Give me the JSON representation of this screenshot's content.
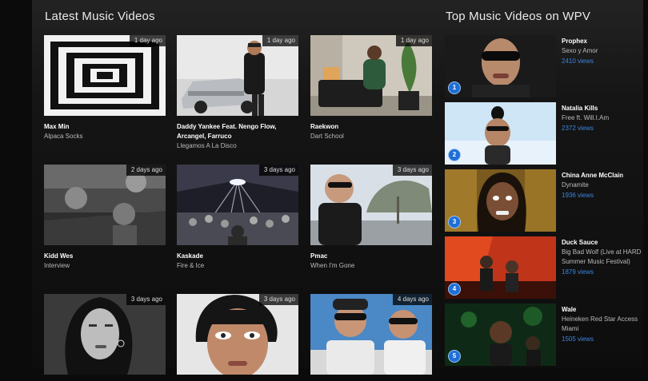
{
  "latest": {
    "title": "Latest Music Videos",
    "items": [
      {
        "age": "1 day ago",
        "artist": "Max Min",
        "song": "Alpaca Socks"
      },
      {
        "age": "1 day ago",
        "artist": "Daddy Yankee Feat. Nengo Flow, Arcangel, Farruco",
        "song": "Llegamos A La Disco"
      },
      {
        "age": "1 day ago",
        "artist": "Raekwon",
        "song": "Dart School"
      },
      {
        "age": "2 days ago",
        "artist": "Kidd Wes",
        "song": "Interview"
      },
      {
        "age": "3 days ago",
        "artist": "Kaskade",
        "song": "Fire & Ice"
      },
      {
        "age": "3 days ago",
        "artist": "Pmac",
        "song": "When I'm Gone"
      },
      {
        "age": "3 days ago",
        "artist": "",
        "song": ""
      },
      {
        "age": "3 days ago",
        "artist": "",
        "song": ""
      },
      {
        "age": "4 days ago",
        "artist": "",
        "song": ""
      }
    ]
  },
  "top": {
    "title": "Top Music Videos on WPV",
    "items": [
      {
        "rank": "1",
        "artist": "Prophex",
        "song": "Sexo y Amor",
        "views": "2410 views"
      },
      {
        "rank": "2",
        "artist": "Natalia Kills",
        "song": "Free ft. Will.I.Am",
        "views": "2372 views"
      },
      {
        "rank": "3",
        "artist": "China Anne McClain",
        "song": "Dynamite",
        "views": "1936 views"
      },
      {
        "rank": "4",
        "artist": "Duck Sauce",
        "song": "Big Bad Wolf (Live at HARD Summer Music Festival)",
        "views": "1879 views"
      },
      {
        "rank": "5",
        "artist": "Wale",
        "song": "Heineken Red Star Access Miami",
        "views": "1505 views"
      }
    ]
  }
}
